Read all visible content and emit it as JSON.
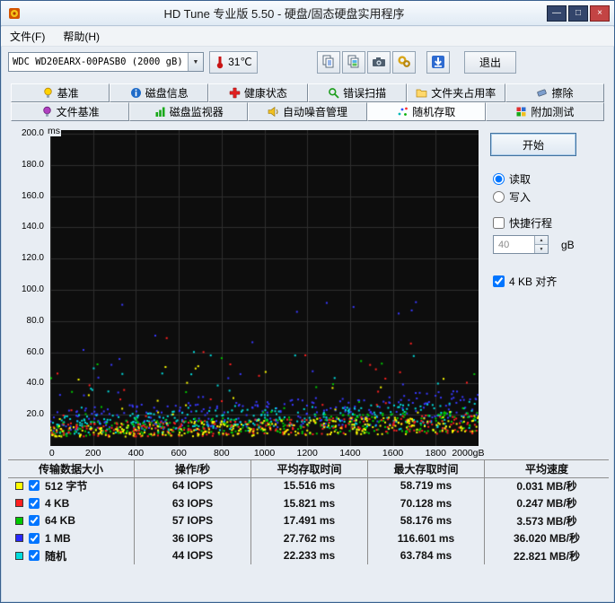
{
  "window": {
    "title": "HD Tune 专业版 5.50 - 硬盘/固态硬盘实用程序",
    "controls": {
      "minimize": "—",
      "maximize": "□",
      "close": "×"
    }
  },
  "menu": {
    "items": [
      {
        "label": "文件(F)"
      },
      {
        "label": "帮助(H)"
      }
    ]
  },
  "toolbar": {
    "drive_select_value": "WDC WD20EARX-00PASB0 (2000 gB)",
    "temperature": "31℃",
    "exit_label": "退出"
  },
  "tabs": {
    "row1": [
      {
        "label": "基准"
      },
      {
        "label": "磁盘信息"
      },
      {
        "label": "健康状态"
      },
      {
        "label": "错误扫描"
      },
      {
        "label": "文件夹占用率"
      },
      {
        "label": "擦除"
      }
    ],
    "row2": [
      {
        "label": "文件基准"
      },
      {
        "label": "磁盘监视器"
      },
      {
        "label": "自动噪音管理"
      },
      {
        "label": "随机存取"
      },
      {
        "label": "附加测试"
      }
    ],
    "active": "随机存取"
  },
  "panel": {
    "start_label": "开始",
    "read_label": "读取",
    "write_label": "写入",
    "short_stroke_label": "快捷行程",
    "short_stroke_value": "40",
    "short_stroke_unit": "gB",
    "align_label": "4 KB 对齐"
  },
  "results_table": {
    "headers": [
      "传输数据大小",
      "操作/秒",
      "平均存取时间",
      "最大存取时间",
      "平均速度"
    ],
    "rows": [
      {
        "label": "512 字节",
        "color": "#FFFF00",
        "ops": "64 IOPS",
        "avg": "15.516 ms",
        "max": "58.719 ms",
        "speed": "0.031 MB/秒"
      },
      {
        "label": "4 KB",
        "color": "#FF2020",
        "ops": "63 IOPS",
        "avg": "15.821 ms",
        "max": "70.128 ms",
        "speed": "0.247 MB/秒"
      },
      {
        "label": "64 KB",
        "color": "#00C800",
        "ops": "57 IOPS",
        "avg": "17.491 ms",
        "max": "58.176 ms",
        "speed": "3.573 MB/秒"
      },
      {
        "label": "1 MB",
        "color": "#2828FF",
        "ops": "36 IOPS",
        "avg": "27.762 ms",
        "max": "116.601 ms",
        "speed": "36.020 MB/秒"
      },
      {
        "label": "随机",
        "color": "#00DCDC",
        "ops": "44 IOPS",
        "avg": "22.233 ms",
        "max": "63.784 ms",
        "speed": "22.821 MB/秒"
      }
    ]
  },
  "chart_data": {
    "type": "scatter",
    "xlabel": "gB",
    "ylabel": "ms",
    "y_unit": "ms",
    "xlim": [
      0,
      2000
    ],
    "ylim": [
      0,
      200
    ],
    "x_ticks": [
      "0",
      "200",
      "400",
      "600",
      "800",
      "1000",
      "1200",
      "1400",
      "1600",
      "1800",
      "2000gB"
    ],
    "y_ticks": [
      "200.0",
      "180.0",
      "160.0",
      "140.0",
      "120.0",
      "100.0",
      "80.0",
      "60.0",
      "40.0",
      "20.0"
    ],
    "background": "#0D0D0D",
    "grid_color": "#2E2E2E",
    "grid": true,
    "series": [
      {
        "name": "512 字节",
        "color": "#FFFF00",
        "avg_ms": 15.516,
        "max_ms": 58.719,
        "points": 300
      },
      {
        "name": "4 KB",
        "color": "#FF2020",
        "avg_ms": 15.821,
        "max_ms": 70.128,
        "points": 300
      },
      {
        "name": "64 KB",
        "color": "#00C800",
        "avg_ms": 17.491,
        "max_ms": 58.176,
        "points": 300
      },
      {
        "name": "1 MB",
        "color": "#3838FF",
        "avg_ms": 27.762,
        "max_ms": 116.601,
        "points": 300
      },
      {
        "name": "随机",
        "color": "#00DCDC",
        "avg_ms": 22.233,
        "max_ms": 63.784,
        "points": 300
      }
    ]
  }
}
